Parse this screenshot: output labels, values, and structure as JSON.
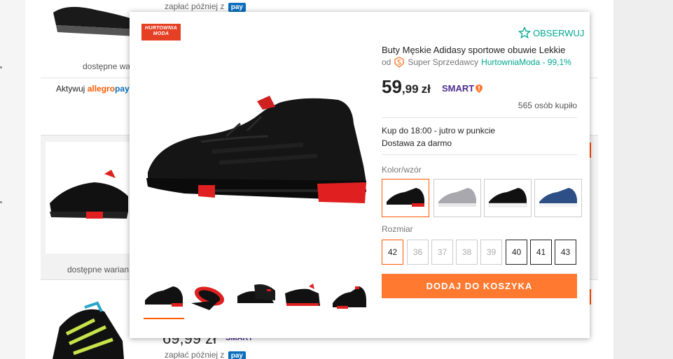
{
  "background": {
    "zaplac_text": "zapłać później z",
    "pay_badge": "pay",
    "variants_text": "dostępne warian",
    "aktywuj_text": "Aktywuj",
    "allegro_text": "allegro",
    "pay_text": "pay",
    "price_fragment": "69,99 zł",
    "smart_fragment": "SMART"
  },
  "popup": {
    "logo_text": "HURTOWNIA MODA",
    "follow_label": "OBSERWUJ",
    "title": "Buty Męskie Adidasy sportowe obuwie Lekkie",
    "seller_prefix": "od",
    "super_seller_label": "Super Sprzedawcy",
    "seller_link": "HurtowniaModa - 99,1%",
    "price_int": "59",
    "price_frac": ",99",
    "price_currency": "zł",
    "smart_label": "SMART",
    "bought_count": "565 osób kupiło",
    "delivery_time": "Kup do 18:00 - jutro w punkcie",
    "delivery_free": "Dostawa za darmo",
    "color_label": "Kolor/wzór",
    "size_label": "Rozmiar",
    "sizes": [
      "42",
      "36",
      "37",
      "38",
      "39",
      "40",
      "41",
      "43"
    ],
    "add_to_cart": "DODAJ DO KOSZYKA",
    "variant_colors": [
      "black-red",
      "grey",
      "black-white",
      "navy-blue"
    ],
    "accent_color": "#ff5a00",
    "seller_color": "#00a790"
  }
}
